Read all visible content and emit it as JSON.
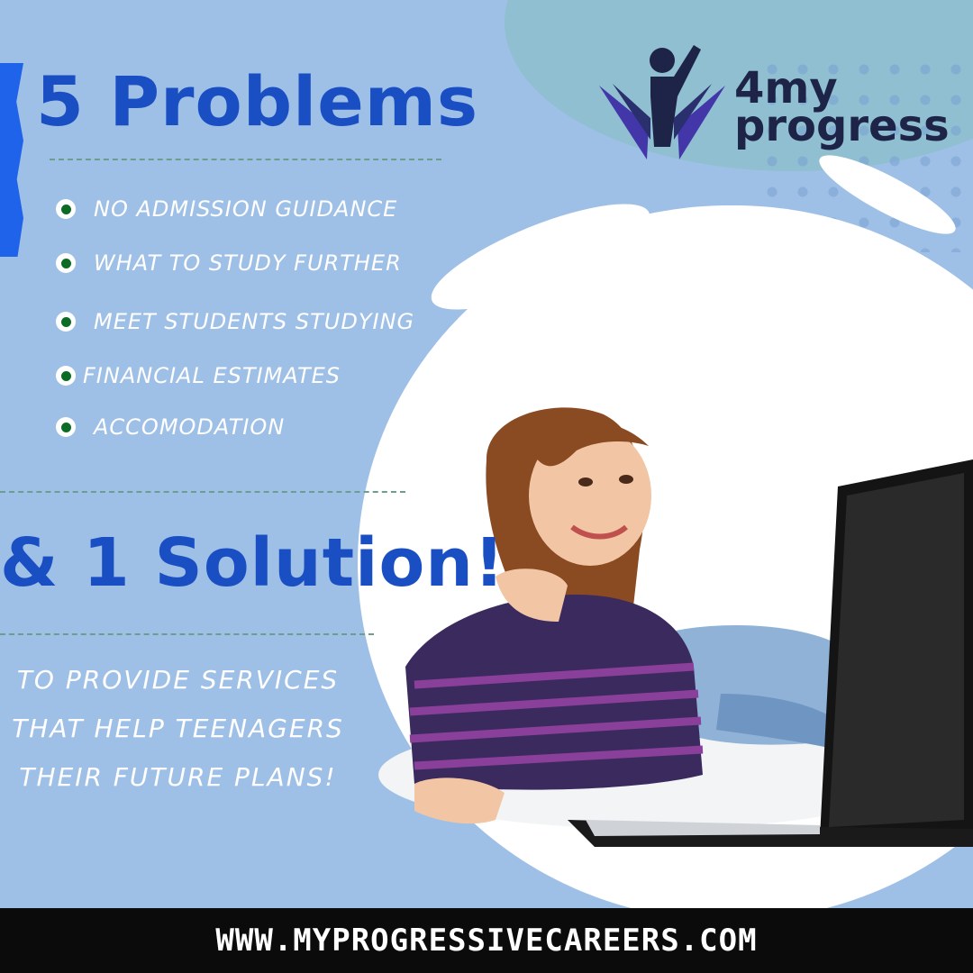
{
  "headline": "5 Problems",
  "problems": [
    "NO ADMISSION GUIDANCE",
    "WHAT TO STUDY FURTHER",
    "MEET STUDENTS STUDYING",
    "FINANCIAL ESTIMATES",
    "ACCOMODATION"
  ],
  "solution_heading": "& 1 Solution!",
  "mission": [
    "TO PROVIDE SERVICES",
    "THAT HELP TEENAGERS",
    "THEIR FUTURE PLANS!"
  ],
  "logo": {
    "line1": "4my",
    "line2": "progress"
  },
  "footer_url": "WWW.MYPROGRESSIVECAREERS.COM",
  "colors": {
    "background": "#9fc0e6",
    "headline": "#1a4fc4",
    "bullet": "#0c6b24",
    "footer": "#0b0b0b",
    "logo_primary": "#1e2448",
    "logo_accent": "#4336a8"
  },
  "icons": [
    "bullet-dot-icon",
    "logo-figure-icon",
    "laptop-illustration"
  ]
}
